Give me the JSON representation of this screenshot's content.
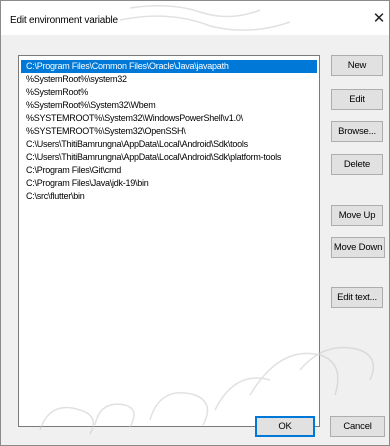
{
  "dialog": {
    "title": "Edit environment variable",
    "close_glyph": "✕"
  },
  "paths": {
    "selected_index": 0,
    "items": [
      "C:\\Program Files\\Common Files\\Oracle\\Java\\javapath",
      "%SystemRoot%\\system32",
      "%SystemRoot%",
      "%SystemRoot%\\System32\\Wbem",
      "%SYSTEMROOT%\\System32\\WindowsPowerShell\\v1.0\\",
      "%SYSTEMROOT%\\System32\\OpenSSH\\",
      "C:\\Users\\ThitiBamrungna\\AppData\\Local\\Android\\Sdk\\tools",
      "C:\\Users\\ThitiBamrungna\\AppData\\Local\\Android\\Sdk\\platform-tools",
      "C:\\Program Files\\Git\\cmd",
      "C:\\Program Files\\Java\\jdk-19\\bin",
      "C:\\src\\flutter\\bin"
    ]
  },
  "buttons": {
    "new": "New",
    "edit": "Edit",
    "browse": "Browse...",
    "delete": "Delete",
    "move_up": "Move Up",
    "move_down": "Move Down",
    "edit_text": "Edit text...",
    "ok": "OK",
    "cancel": "Cancel"
  },
  "colors": {
    "selection": "#0078d7",
    "window_bg": "#f0f0f0",
    "list_bg": "#ffffff",
    "watermark": "#c9c9c9"
  }
}
